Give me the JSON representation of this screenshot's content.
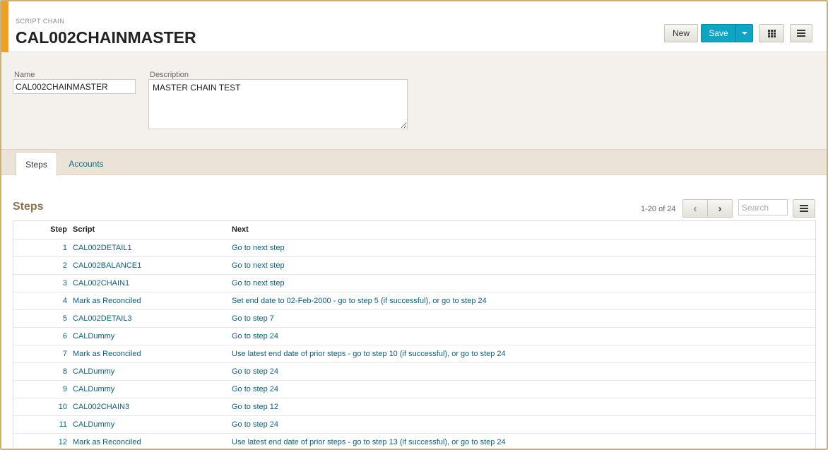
{
  "header": {
    "record_type": "SCRIPT CHAIN",
    "title": "CAL002CHAINMASTER",
    "buttons": {
      "new_label": "New",
      "save_label": "Save"
    }
  },
  "form": {
    "name_label": "Name",
    "name_value": "CAL002CHAINMASTER",
    "description_label": "Description",
    "description_value": "MASTER CHAIN TEST"
  },
  "tabs": [
    {
      "label": "Steps",
      "active": true
    },
    {
      "label": "Accounts",
      "active": false
    }
  ],
  "steps_section": {
    "title": "Steps",
    "pager_text": "1-20 of 24",
    "search_placeholder": "Search",
    "columns": [
      "Step",
      "Script",
      "Next"
    ],
    "rows": [
      {
        "step": "1",
        "script": "CAL002DETAIL1",
        "next": "Go to next step"
      },
      {
        "step": "2",
        "script": "CAL002BALANCE1",
        "next": "Go to next step"
      },
      {
        "step": "3",
        "script": "CAL002CHAIN1",
        "next": "Go to next step"
      },
      {
        "step": "4",
        "script": "Mark as Reconciled",
        "next": "Set end date to 02-Feb-2000 - go to step 5 (if successful), or go to step 24"
      },
      {
        "step": "5",
        "script": "CAL002DETAIL3",
        "next": "Go to step 7"
      },
      {
        "step": "6",
        "script": "CALDummy",
        "next": "Go to step 24"
      },
      {
        "step": "7",
        "script": "Mark as Reconciled",
        "next": "Use latest end date of prior steps - go to step 10 (if successful), or go to step 24"
      },
      {
        "step": "8",
        "script": "CALDummy",
        "next": "Go to step 24"
      },
      {
        "step": "9",
        "script": "CALDummy",
        "next": "Go to step 24"
      },
      {
        "step": "10",
        "script": "CAL002CHAIN3",
        "next": "Go to step 12"
      },
      {
        "step": "11",
        "script": "CALDummy",
        "next": "Go to step 24"
      },
      {
        "step": "12",
        "script": "Mark as Reconciled",
        "next": "Use latest end date of prior steps - go to step 13 (if successful), or go to step 24"
      }
    ]
  },
  "colors": {
    "accent": "#f0a020",
    "save_button": "#0fa4c4",
    "link": "#0e5f77",
    "section_title": "#8a7350"
  },
  "icons": [
    "caret-down-icon",
    "grid-icon",
    "hamburger-icon",
    "chevron-left-icon",
    "chevron-right-icon"
  ]
}
